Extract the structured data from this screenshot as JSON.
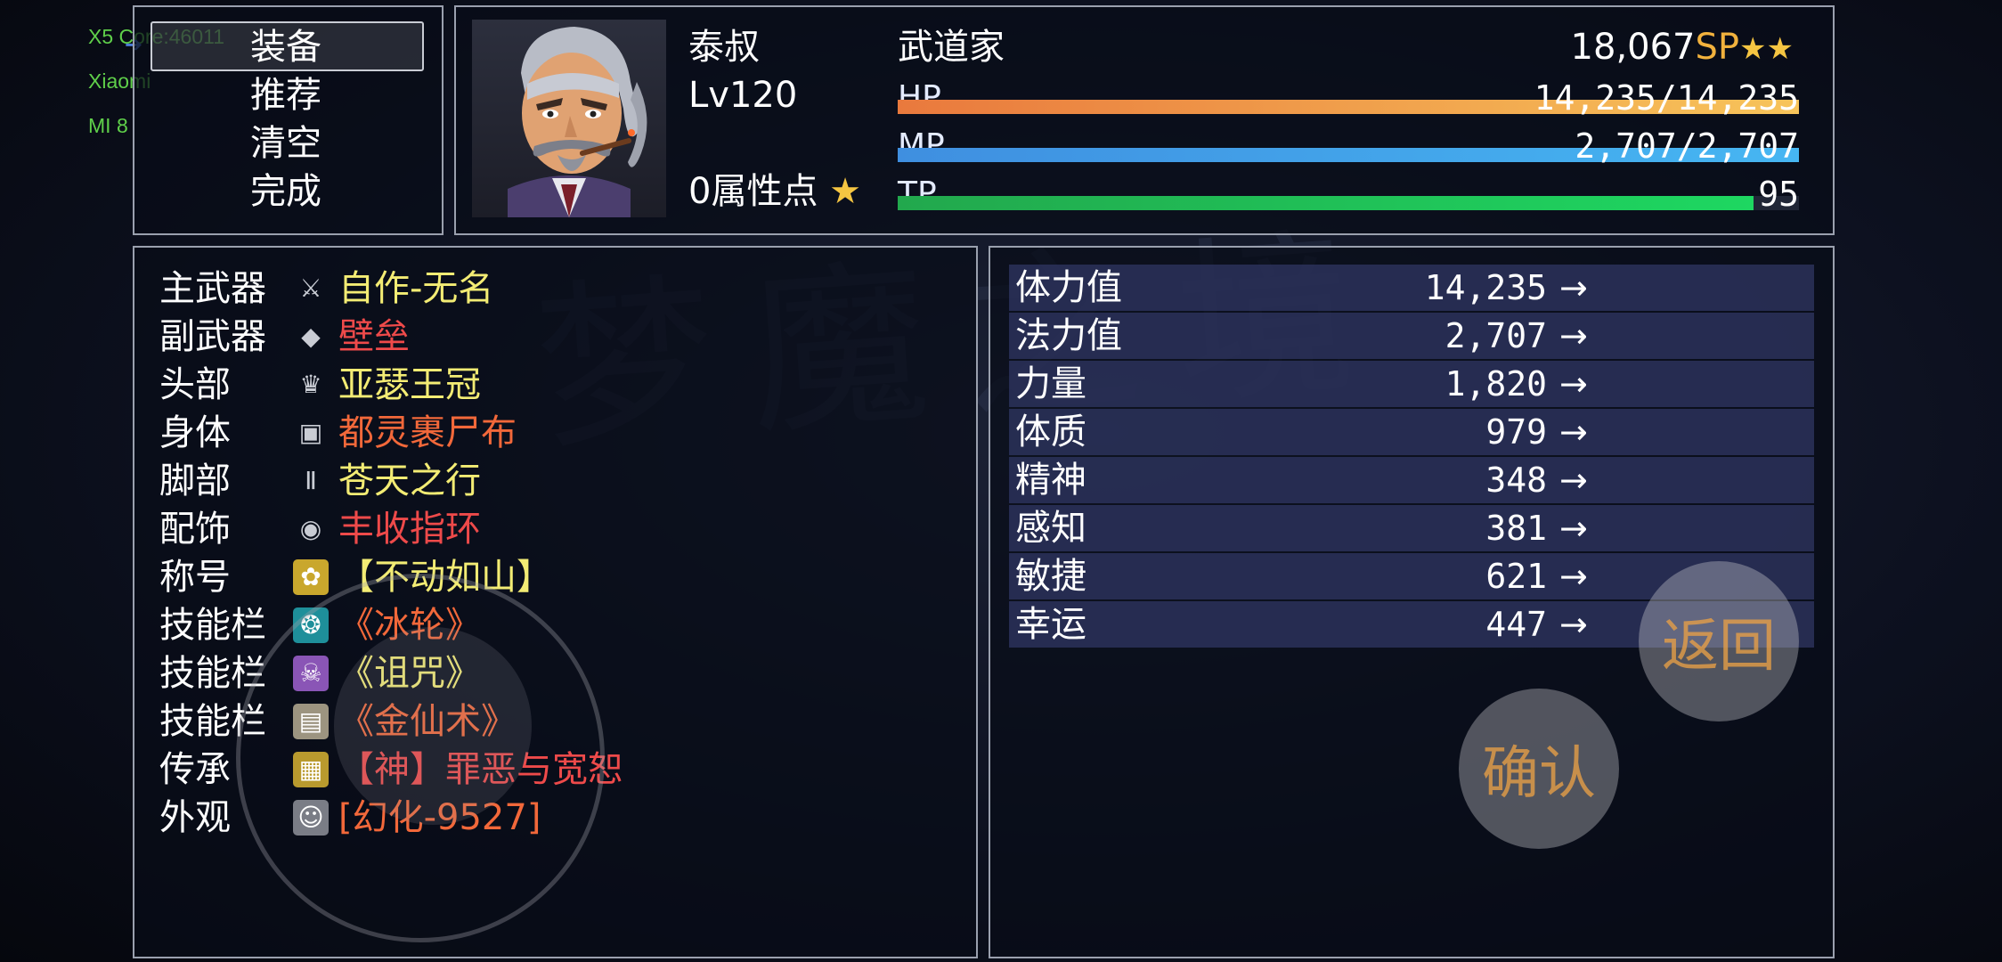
{
  "overlay": {
    "line1": "X5 Core:46011",
    "line2": "Xiaomi",
    "line3": "MI 8"
  },
  "command_menu": {
    "items": [
      "装备",
      "推荐",
      "清空",
      "完成"
    ],
    "selected_index": 0
  },
  "status": {
    "name": "泰叔",
    "class": "武道家",
    "level": "Lv120",
    "attribute_points": "0属性点",
    "sp_value": "18,067",
    "sp_unit": "SP",
    "hp_label": "HP",
    "hp_value": "14,235/14,235",
    "hp_ratio": 1.0,
    "mp_label": "MP",
    "mp_value": "2,707/2,707",
    "mp_ratio": 1.0,
    "tp_label": "TP",
    "tp_value": "95",
    "tp_ratio": 0.95
  },
  "equipment": [
    {
      "slot": "主武器",
      "name": "自作-无名",
      "color": "#f3ec74",
      "icon": "sword-icon"
    },
    {
      "slot": "副武器",
      "name": "壁垒",
      "color": "#ee4a4a",
      "icon": "blade-icon"
    },
    {
      "slot": "头部",
      "name": "亚瑟王冠",
      "color": "#f3ec74",
      "icon": "crown-icon"
    },
    {
      "slot": "身体",
      "name": "都灵裹尸布",
      "color": "#f2683a",
      "icon": "armor-icon"
    },
    {
      "slot": "脚部",
      "name": "苍天之行",
      "color": "#f3ec74",
      "icon": "boots-icon"
    },
    {
      "slot": "配饰",
      "name": "丰收指环",
      "color": "#ee4a4a",
      "icon": "ring-icon"
    },
    {
      "slot": "称号",
      "name": "【不动如山】",
      "color": "#f3ec74",
      "icon": "badge-icon"
    },
    {
      "slot": "技能栏",
      "name": "《冰轮》",
      "color": "#f2683a",
      "icon": "ice-wheel-icon"
    },
    {
      "slot": "技能栏",
      "name": "《诅咒》",
      "color": "#f3ec74",
      "icon": "curse-skull-icon"
    },
    {
      "slot": "技能栏",
      "name": "《金仙术》",
      "color": "#f2683a",
      "icon": "scroll-icon"
    },
    {
      "slot": "传承",
      "name": "【神】罪恶与宽恕",
      "color": "#ee4a4a",
      "icon": "treasure-chest-icon"
    },
    {
      "slot": "外观",
      "name": "[幻化-9527]",
      "color": "#f2683a",
      "icon": "face-icon"
    }
  ],
  "params": [
    {
      "name": "体力值",
      "value": "14,235",
      "arrow": "→"
    },
    {
      "name": "法力值",
      "value": "2,707",
      "arrow": "→"
    },
    {
      "name": "力量",
      "value": "1,820",
      "arrow": "→"
    },
    {
      "name": "体质",
      "value": "979",
      "arrow": "→"
    },
    {
      "name": "精神",
      "value": "348",
      "arrow": "→"
    },
    {
      "name": "感知",
      "value": "381",
      "arrow": "→"
    },
    {
      "name": "敏捷",
      "value": "621",
      "arrow": "→"
    },
    {
      "name": "幸运",
      "value": "447",
      "arrow": "→"
    }
  ],
  "buttons": {
    "back": "返回",
    "confirm": "确认"
  },
  "colors": {
    "system_blue": "#84aaff",
    "hp_start": "#e9793d",
    "hp_end": "#f7c45a",
    "mp_start": "#3f8fe0",
    "mp_end": "#46b6f2",
    "tp_start": "#22a84d",
    "tp_end": "#1ed761",
    "sp": "#f2b23d"
  }
}
